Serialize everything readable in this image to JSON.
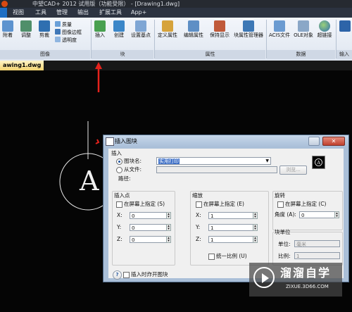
{
  "app": {
    "title": "中望CAD+ 2012 试用版（功能受限） - [Drawing1.dwg]"
  },
  "menubar": {
    "items": [
      "视图",
      "工具",
      "管理",
      "输出",
      "扩展工具",
      "App+"
    ]
  },
  "ribbon": {
    "buttons": {
      "attach": "附着",
      "adjust": "调整",
      "clip": "剪裁",
      "insert": "插入",
      "create": "创建",
      "set_base": "设置基点",
      "define_attr": "定义属性",
      "edit_attr": "编辑属性",
      "sync": "保持显示",
      "block_attr_mgr": "块属性管理器",
      "acis": "ACIS文件",
      "ole": "OLE对象",
      "hyperlink": "超链接"
    },
    "small": {
      "quality": "质量",
      "image_frame": "图像边框",
      "transparency": "透明度"
    },
    "groups": {
      "image": "图像",
      "block": "块",
      "attribute": "属性",
      "data": "数据",
      "import": "输入"
    }
  },
  "doc_tab": "awing1.dwg",
  "canvas": {
    "letter": "A"
  },
  "dialog": {
    "title": "插入图块",
    "insert_group": "插入",
    "block_name_label": "图块名:",
    "block_name_value": "实用打印",
    "from_file_label": "从文件:",
    "browse_btn": "浏览...",
    "path_label": "路径:",
    "insert_point": {
      "title": "插入点",
      "on_screen": "在屏幕上指定 (S)",
      "x_label": "X:",
      "x": "0",
      "y_label": "Y:",
      "y": "0",
      "z_label": "Z:",
      "z": "0"
    },
    "scale": {
      "title": "缩放",
      "on_screen": "在屏幕上指定 (E)",
      "x_label": "X:",
      "x": "1",
      "y_label": "Y:",
      "y": "1",
      "z_label": "Z:",
      "z": "1",
      "uniform": "统一比例 (U)"
    },
    "rotation": {
      "title": "旋转",
      "on_screen": "在屏幕上指定 (C)",
      "angle_label": "角度 (A):",
      "angle": "0"
    },
    "block_unit": {
      "title": "块单位",
      "unit_label": "单位:",
      "unit": "毫米",
      "ratio_label": "比例:",
      "ratio": "1"
    },
    "explode": "插入时炸开图块",
    "help": "?"
  },
  "watermark": {
    "name": "溜溜自学",
    "url": "ZIXUE.3D66.COM"
  },
  "colors": {
    "arrow": "#e5221c",
    "selection": "#3d6fc7"
  }
}
